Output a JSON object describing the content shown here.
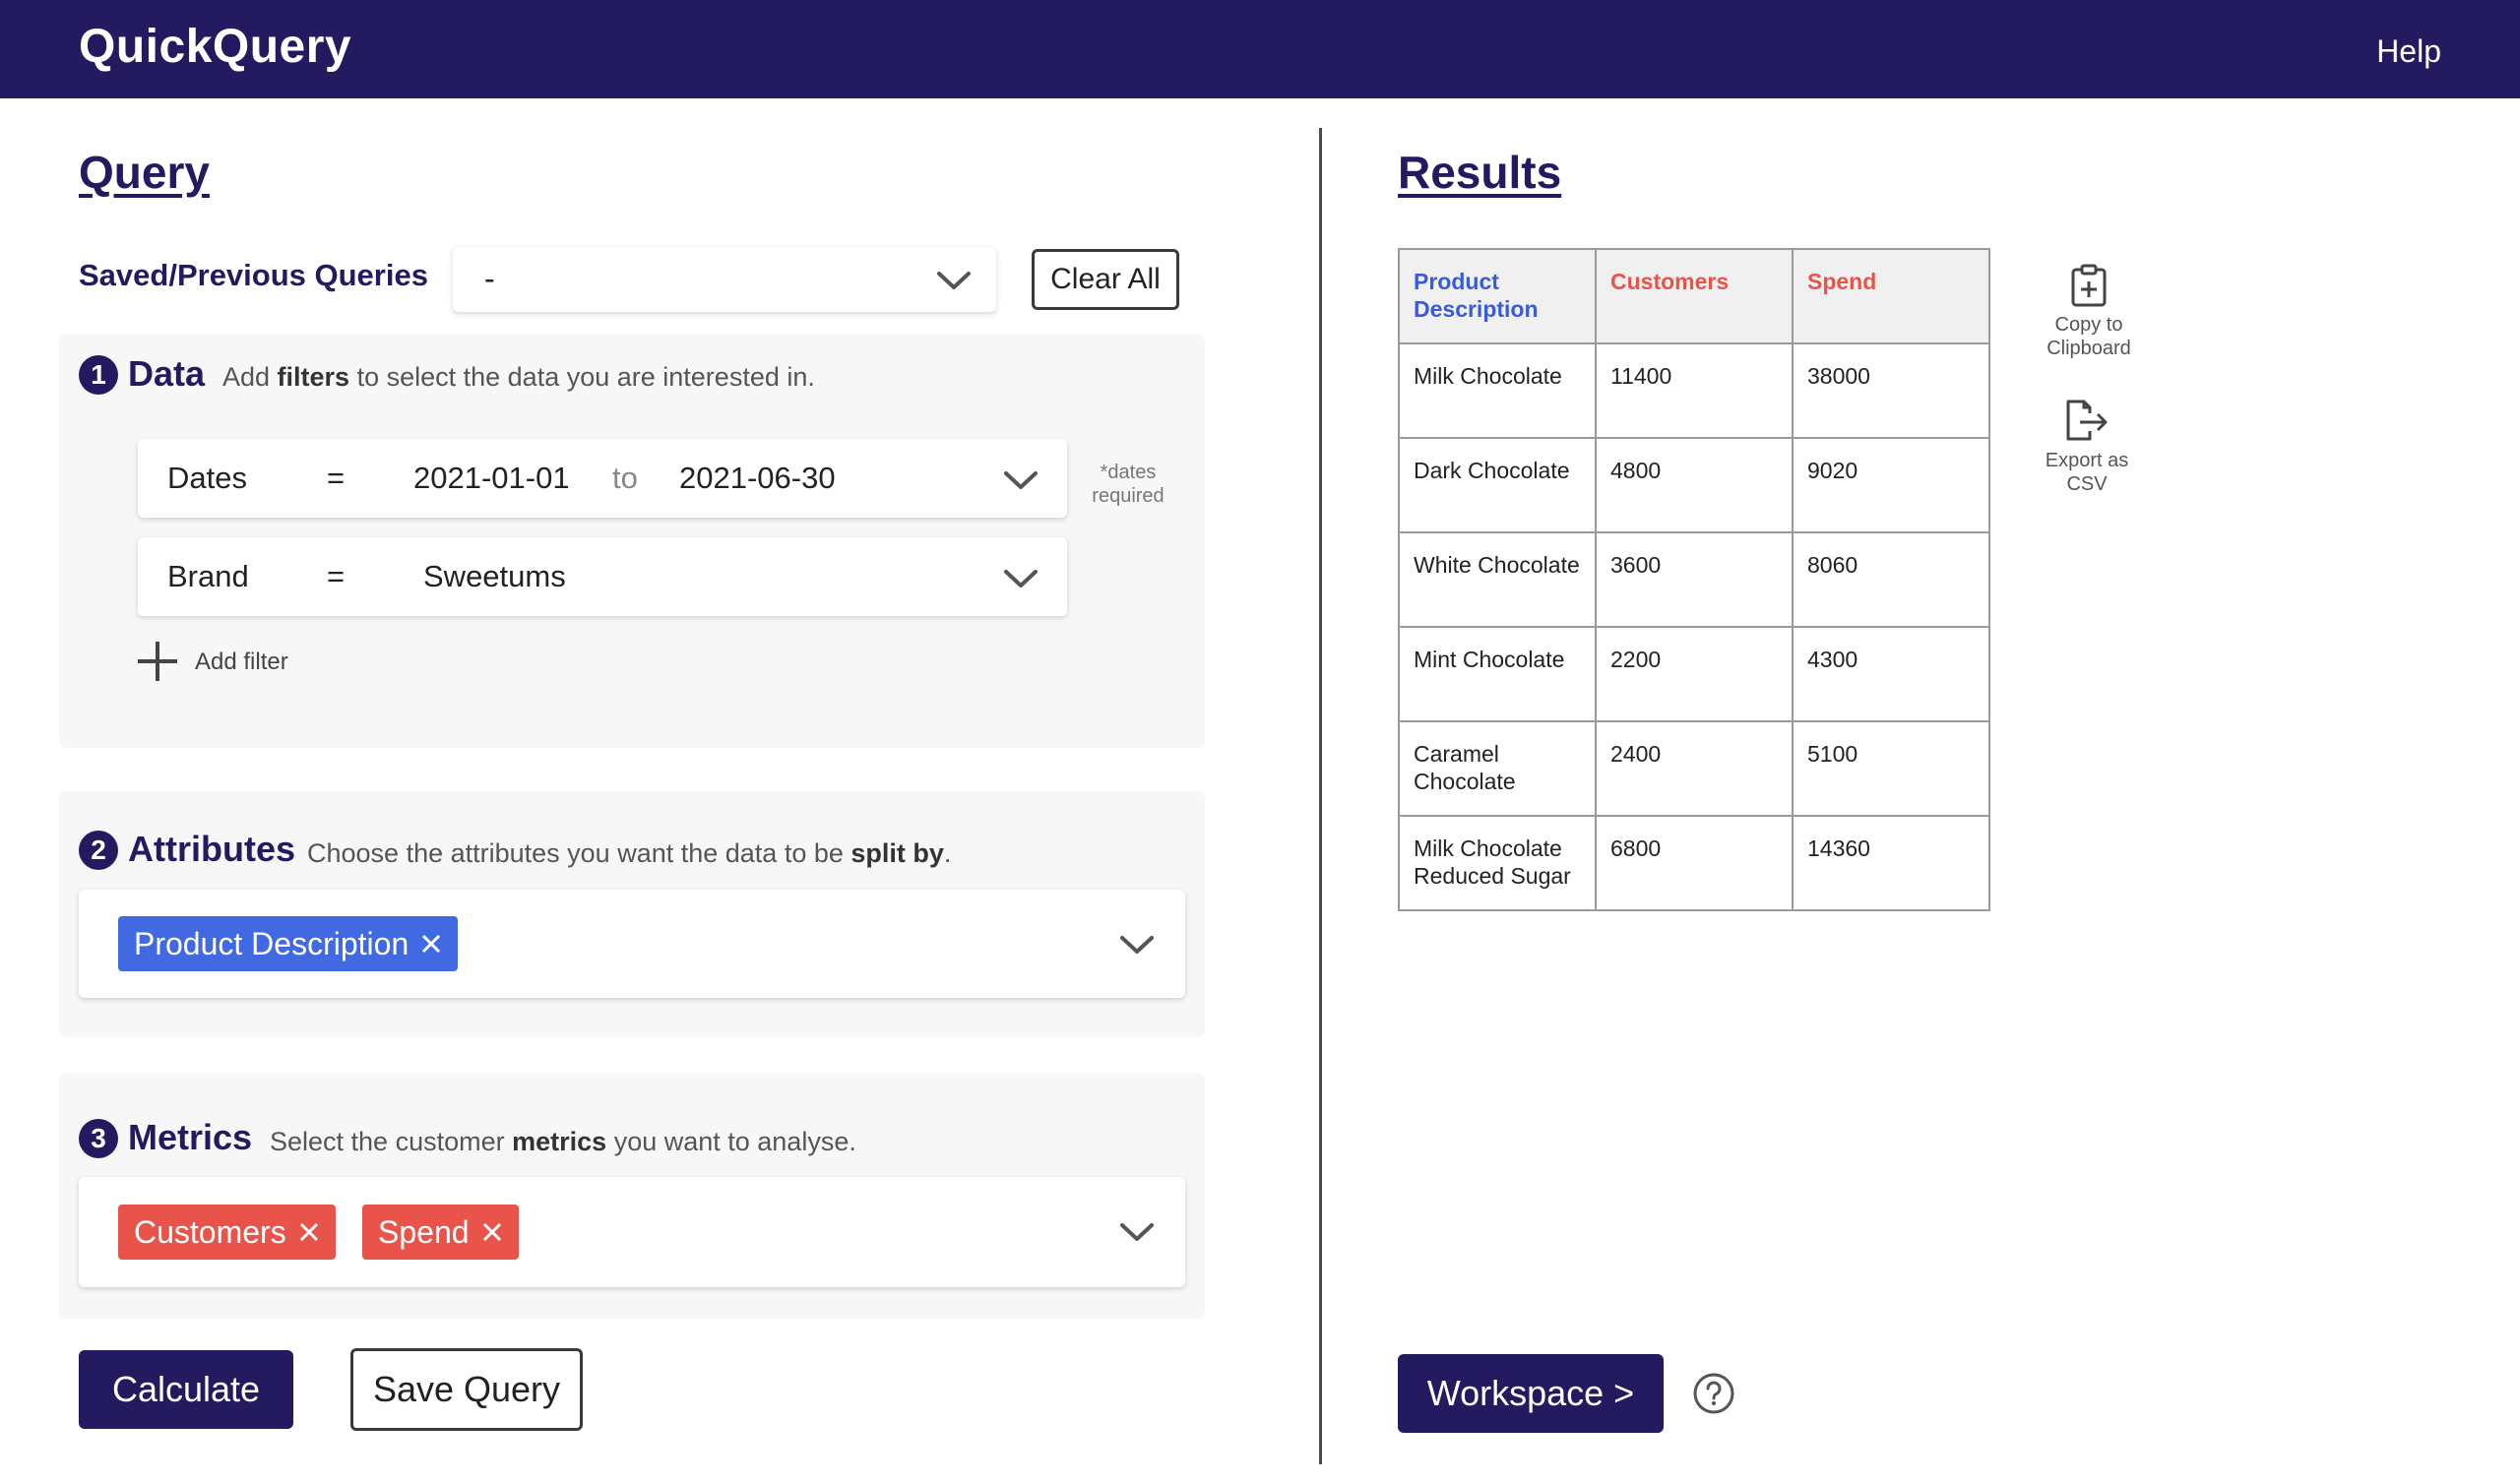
{
  "header": {
    "app_title": "QuickQuery",
    "help_label": "Help"
  },
  "query": {
    "heading": "Query",
    "saved_label": "Saved/Previous Queries",
    "saved_value": "-",
    "clear_all_label": "Clear All",
    "data_step": {
      "number": "1",
      "title": "Data",
      "desc_pre": "Add ",
      "desc_bold": "filters",
      "desc_post": " to select the data you are interested in.",
      "filters": [
        {
          "field": "Dates",
          "operator": "=",
          "from": "2021-01-01",
          "to_word": "to",
          "to": "2021-06-30"
        },
        {
          "field": "Brand",
          "operator": "=",
          "value": "Sweetums"
        }
      ],
      "dates_note": "*dates required",
      "add_filter_label": "Add filter"
    },
    "attributes_step": {
      "number": "2",
      "title": "Attributes",
      "desc_pre": "Choose the attributes you want the data to be ",
      "desc_bold": "split by",
      "desc_post": ".",
      "chips": [
        "Product Description"
      ]
    },
    "metrics_step": {
      "number": "3",
      "title": "Metrics",
      "desc_pre": "Select the customer ",
      "desc_bold": "metrics",
      "desc_post": " you want to analyse.",
      "chips": [
        "Customers",
        "Spend"
      ]
    },
    "calculate_label": "Calculate",
    "save_query_label": "Save Query"
  },
  "results": {
    "heading": "Results",
    "columns": [
      "Product Description",
      "Customers",
      "Spend"
    ],
    "rows": [
      [
        "Milk Chocolate",
        "11400",
        "38000"
      ],
      [
        "Dark Chocolate",
        "4800",
        "9020"
      ],
      [
        "White Chocolate",
        "3600",
        "8060"
      ],
      [
        "Mint Chocolate",
        "2200",
        "4300"
      ],
      [
        "Caramel Chocolate",
        "2400",
        "5100"
      ],
      [
        "Milk Chocolate Reduced Sugar",
        "6800",
        "14360"
      ]
    ],
    "copy_label": "Copy to Clipboard",
    "export_label": "Export as CSV",
    "workspace_label": "Workspace >"
  },
  "colors": {
    "brand": "#241a5f",
    "attribute_chip": "#4169e1",
    "metric_chip": "#e8544a",
    "panel_bg": "#f7f7f7"
  },
  "icons": [
    "chevron-down-icon",
    "plus-icon",
    "close-icon",
    "clipboard-plus-icon",
    "export-file-icon",
    "help-circle-icon"
  ]
}
